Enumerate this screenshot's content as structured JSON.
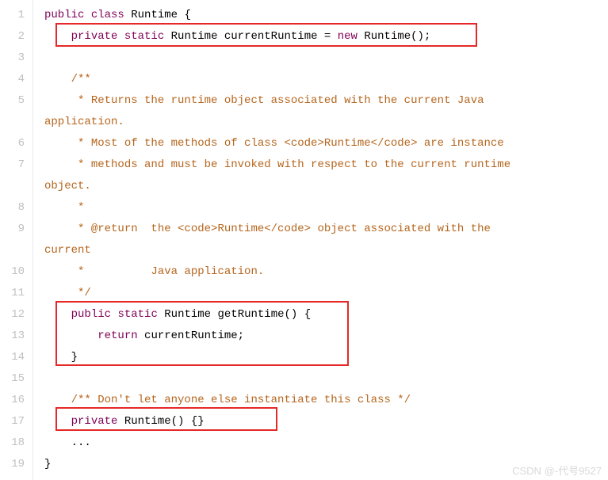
{
  "gutter": [
    "1",
    "2",
    "3",
    "4",
    "5",
    "",
    "6",
    "7",
    "",
    "8",
    "9",
    "",
    "10",
    "11",
    "12",
    "13",
    "14",
    "15",
    "16",
    "17",
    "18",
    "19"
  ],
  "code": {
    "l1": {
      "kw1": "public",
      "kw2": "class",
      "cls": "Runtime",
      "br": "{"
    },
    "l2": {
      "kw1": "private",
      "kw2": "static",
      "ty": "Runtime",
      "id": "currentRuntime",
      "eq": "=",
      "kw3": "new",
      "ctor": "Runtime();"
    },
    "l4": "/**",
    "l5a": " * Returns the runtime object associated with the current Java ",
    "l5b": "application.",
    "l6": " * Most of the methods of class <code>Runtime</code> are instance",
    "l7a": " * methods and must be invoked with respect to the current runtime ",
    "l7b": "object.",
    "l8": " *",
    "l9a": " * @return  the <code>Runtime</code> object associated with the ",
    "l9b": "current",
    "l10": " *          Java application.",
    "l11": " */",
    "l12": {
      "kw1": "public",
      "kw2": "static",
      "ty": "Runtime",
      "fn": "getRuntime()",
      "br": "{"
    },
    "l13": {
      "kw": "return",
      "id": "currentRuntime;"
    },
    "l14": "}",
    "l16": "/** Don't let anyone else instantiate this class */",
    "l17": {
      "kw1": "private",
      "ctor": "Runtime()",
      "br": "{}"
    },
    "l18": "...",
    "l19": "}"
  },
  "watermark": "CSDN @-代号9527"
}
